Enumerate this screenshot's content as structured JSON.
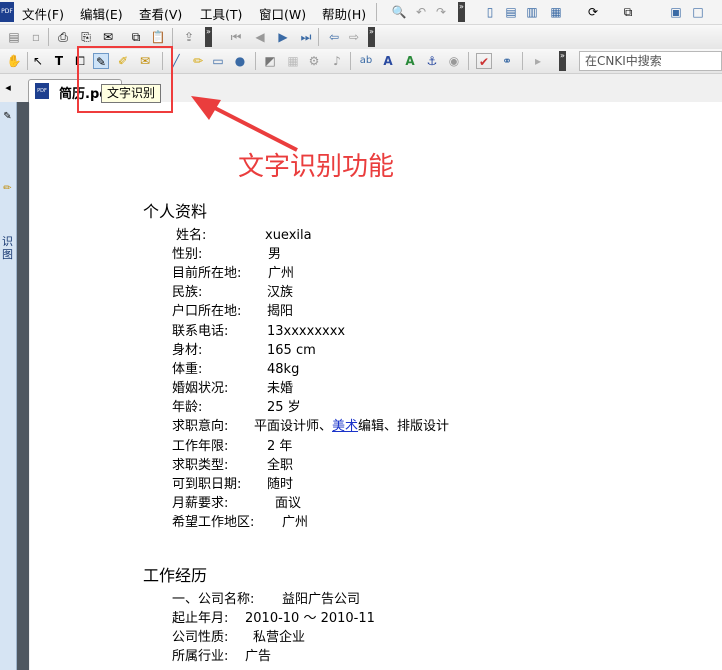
{
  "app": {
    "icon_text": "PDF"
  },
  "menu": [
    "文件(F)",
    "编辑(E)",
    "查看(V)",
    "工具(T)",
    "窗口(W)",
    "帮助(H)"
  ],
  "search": {
    "placeholder": "在CNKI中搜索"
  },
  "tab": {
    "label": "简历.pc",
    "icon_text": "PDF"
  },
  "tooltip": {
    "text": "文字识别"
  },
  "annotation": {
    "text": "文字识别功能",
    "color": "#ea3d3d"
  },
  "side_panel": {
    "text": "识图"
  },
  "document": {
    "section1_title": "个人资料",
    "personal": [
      {
        "label": "姓名:",
        "value": "xuexila"
      },
      {
        "label": "性别:",
        "value": "男"
      },
      {
        "label": "目前所在地:",
        "value": "广州"
      },
      {
        "label": "民族:",
        "value": "汉族"
      },
      {
        "label": "户口所在地:",
        "value": "揭阳"
      },
      {
        "label": "联系电话:",
        "value": "13xxxxxxxx"
      },
      {
        "label": "身材:",
        "value": "165 cm"
      },
      {
        "label": "体重:",
        "value": "48kg"
      },
      {
        "label": "婚姻状况:",
        "value": "未婚"
      },
      {
        "label": "年龄:",
        "value": "25 岁"
      },
      {
        "label": "求职意向:",
        "value_prefix": "平面设计师、",
        "value_link": "美术",
        "value_suffix": "编辑、排版设计"
      },
      {
        "label": "工作年限:",
        "value": "2 年"
      },
      {
        "label": "求职类型:",
        "value": "全职"
      },
      {
        "label": "可到职日期:",
        "value": "随时"
      },
      {
        "label": "月薪要求:",
        "value": "面议"
      },
      {
        "label": "希望工作地区:",
        "value": "广州"
      }
    ],
    "section2_title": "工作经历",
    "work": [
      {
        "label": "一、公司名称:",
        "value": "益阳广告公司"
      },
      {
        "label": "起止年月:",
        "value": "2010-10 ～ 2010-11"
      },
      {
        "label": "公司性质:",
        "value": "私营企业"
      },
      {
        "label": "所属行业:",
        "value": "广告"
      }
    ]
  }
}
